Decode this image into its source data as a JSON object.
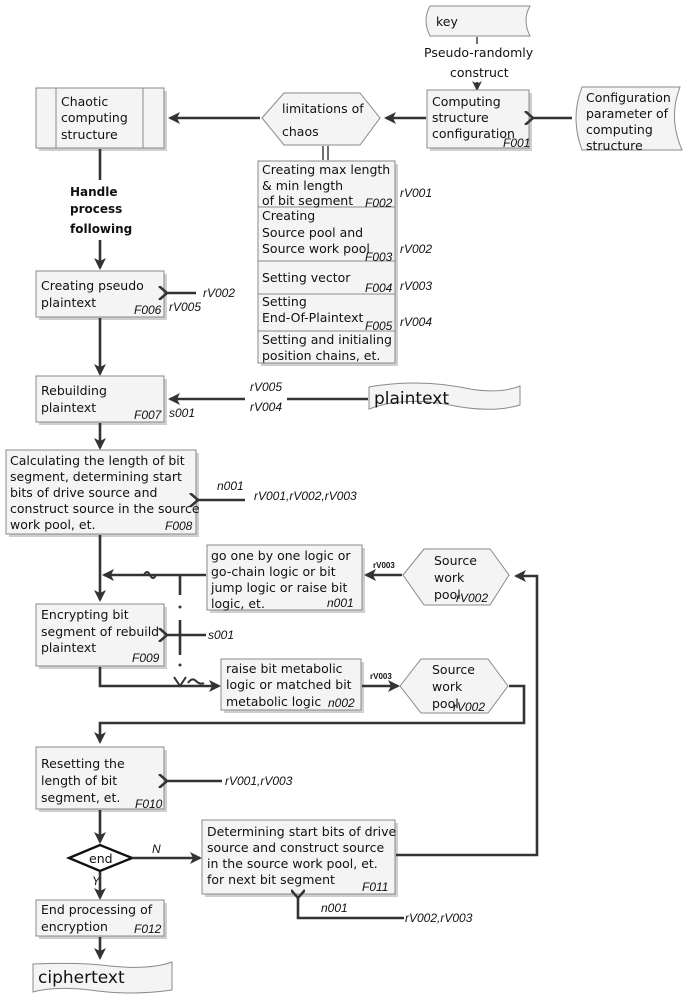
{
  "diagram": {
    "inputs": {
      "key": "key",
      "pseudo_label_1": "Pseudo-randomly",
      "pseudo_label_2": "construct",
      "config_param": [
        "Configuration",
        "parameter of",
        "computing",
        "structure"
      ],
      "plaintext": "plaintext",
      "ciphertext": "ciphertext"
    },
    "nodes": {
      "chaotic": [
        "Chaotic",
        "computing",
        "structure"
      ],
      "limitations": [
        "limitations of",
        "chaos"
      ],
      "f001": {
        "lines": [
          "Computing",
          "structure",
          "configuration"
        ],
        "code": "F001"
      },
      "handle": [
        "Handle",
        "process",
        "following"
      ],
      "init_list": [
        {
          "lines": [
            "Creating max length",
            "& min length",
            "of bit segment"
          ],
          "code": "F002",
          "var": "rV001"
        },
        {
          "lines": [
            "Creating",
            "Source pool and",
            "Source work pool"
          ],
          "code": "F003",
          "var": "rV002"
        },
        {
          "lines": [
            "Setting vector"
          ],
          "code": "F004",
          "var": "rV003"
        },
        {
          "lines": [
            "Setting",
            "End-Of-Plaintext"
          ],
          "code": "F005",
          "var": "rV004"
        },
        {
          "lines": [
            "Setting and initialing",
            "position chains, et."
          ],
          "code": "",
          "var": ""
        }
      ],
      "f006": {
        "lines": [
          "Creating pseudo",
          "plaintext"
        ],
        "code": "F006",
        "in1": "rV002",
        "in2": "rV005"
      },
      "f007": {
        "lines": [
          "Rebuilding",
          "plaintext"
        ],
        "code": "F007",
        "in_s": "s001",
        "in1": "rV005",
        "in2": "rV004"
      },
      "f008": {
        "lines": [
          "Calculating the length of bit",
          "segment, determining start",
          "bits of drive source and",
          "construct source in the source",
          "work pool,  et."
        ],
        "code": "F008",
        "n": "n001",
        "vars": "rV001,rV002,rV003"
      },
      "n001": {
        "lines": [
          "go one by one logic or",
          "go-chain logic or bit",
          "jump logic or raise bit",
          "logic, et."
        ],
        "code": "n001",
        "edge": "rV003"
      },
      "pool1": {
        "lines": [
          "Source",
          "work",
          "pool"
        ],
        "code": "rV002"
      },
      "f009": {
        "lines": [
          "Encrypting bit",
          "segment of rebuild",
          "plaintext"
        ],
        "code": "F009",
        "in_s": "s001"
      },
      "n002": {
        "lines": [
          "raise bit metabolic",
          "logic or matched bit",
          "metabolic logic"
        ],
        "code": "n002",
        "edge": "rV003"
      },
      "pool2": {
        "lines": [
          "Source",
          "work",
          "pool"
        ],
        "code": "rV002"
      },
      "f010": {
        "lines": [
          "Resetting the",
          "length of bit",
          "segment, et."
        ],
        "code": "F010",
        "vars": "rV001,rV003"
      },
      "decision": {
        "label": "end",
        "no": "N",
        "yes": "Y"
      },
      "f011": {
        "lines": [
          "Determining start bits of drive",
          "source and construct source",
          "in the source work pool,  et.",
          "for next bit segment"
        ],
        "code": "F011",
        "n": "n001",
        "vars": "rV002,rV003"
      },
      "f012": {
        "lines": [
          "End processing of",
          "encryption"
        ],
        "code": "F012"
      }
    }
  }
}
